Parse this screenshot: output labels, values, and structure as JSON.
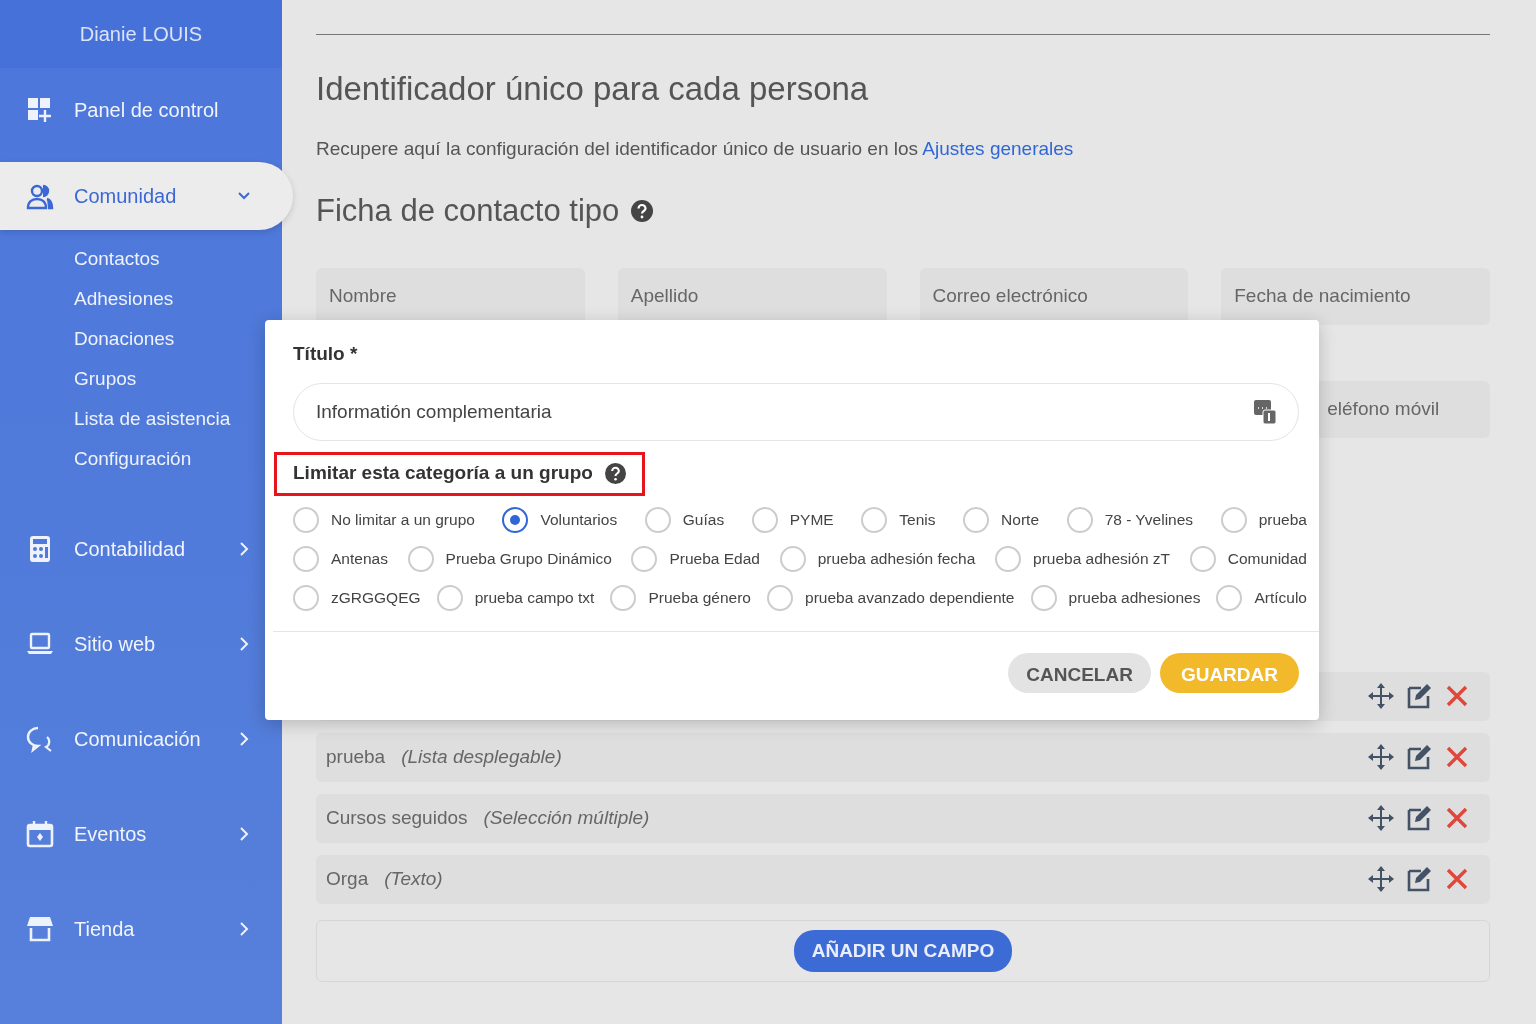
{
  "sidebar": {
    "user": "Dianie LOUIS",
    "items": [
      {
        "label": "Panel de control",
        "kind": "link",
        "selected": false
      },
      {
        "label": "Comunidad",
        "kind": "group",
        "selected": true,
        "expanded": true,
        "children": [
          {
            "label": "Contactos",
            "selected": false
          },
          {
            "label": "Adhesiones",
            "selected": false
          },
          {
            "label": "Donaciones",
            "selected": false
          },
          {
            "label": "Grupos",
            "selected": false
          },
          {
            "label": "Lista de asistencia",
            "selected": false
          },
          {
            "label": "Configuración",
            "selected": false
          }
        ]
      },
      {
        "label": "Contabilidad",
        "kind": "group",
        "selected": false,
        "expanded": false
      },
      {
        "label": "Sitio web",
        "kind": "group",
        "selected": false,
        "expanded": false
      },
      {
        "label": "Comunicación",
        "kind": "group",
        "selected": false,
        "expanded": false
      },
      {
        "label": "Eventos",
        "kind": "group",
        "selected": false,
        "expanded": false
      },
      {
        "label": "Tienda",
        "kind": "group",
        "selected": false,
        "expanded": false
      }
    ]
  },
  "main": {
    "title": "Identificador único para cada persona",
    "intro": "Recupere aquí la configuración del identificador único de usuario en los",
    "intro_link": "Ajustes generales",
    "section_title": "Ficha de contacto tipo",
    "field_rows": [
      [
        "Nombre",
        "Apellido",
        "Correo electrónico",
        "Fecha de nacimiento"
      ],
      [
        "eléfono móvil"
      ]
    ],
    "custom_fields": [
      {
        "kind": "covered"
      },
      {
        "kind": "field",
        "name": "prueba",
        "type": "(Lista desplegable)"
      },
      {
        "kind": "field",
        "name": "Cursos seguidos",
        "type": "(Selección múltiple)"
      },
      {
        "kind": "field",
        "name": "Orga",
        "type": "(Texto)"
      }
    ],
    "add_button": "AÑADIR UN CAMPO"
  },
  "modal": {
    "title_label": "Título *",
    "title_value": "Informatión complementaria",
    "group_label": "Limitar esta categoría a un grupo",
    "groups": [
      [
        {
          "label": "No limitar a un grupo",
          "selected": false
        },
        {
          "label": "Voluntarios",
          "selected": true
        },
        {
          "label": "Guías",
          "selected": false
        },
        {
          "label": "PYME",
          "selected": false
        },
        {
          "label": "Tenis",
          "selected": false
        },
        {
          "label": "Norte",
          "selected": false
        },
        {
          "label": "78 - Yvelines",
          "selected": false
        },
        {
          "label": "prueba",
          "selected": false
        }
      ],
      [
        {
          "label": "Antenas",
          "selected": false
        },
        {
          "label": "Prueba Grupo Dinámico",
          "selected": false
        },
        {
          "label": "Prueba Edad",
          "selected": false
        },
        {
          "label": "prueba adhesión fecha",
          "selected": false
        },
        {
          "label": "prueba adhesión zT",
          "selected": false
        },
        {
          "label": "Comunidad",
          "selected": false
        }
      ],
      [
        {
          "label": "zGRGGQEG",
          "selected": false
        },
        {
          "label": "prueba campo txt",
          "selected": false
        },
        {
          "label": "Prueba género",
          "selected": false
        },
        {
          "label": "prueba avanzado dependiente",
          "selected": false
        },
        {
          "label": "prueba adhesiones",
          "selected": false
        },
        {
          "label": "Artículo",
          "selected": false
        }
      ]
    ],
    "cancel": "CANCELAR",
    "save": "GUARDAR"
  }
}
